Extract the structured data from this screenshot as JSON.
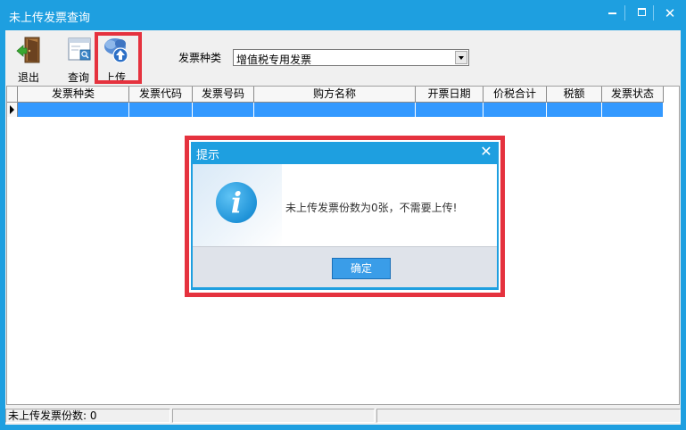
{
  "window": {
    "title": "未上传发票查询",
    "minimize_icon": "minimize-icon",
    "maximize_icon": "maximize-icon",
    "close_glyph": "✕",
    "accent_color": "#1e9fe0"
  },
  "toolbar": {
    "exit_label": "退出",
    "exit_icon": "door-exit-icon",
    "query_label": "查询",
    "query_icon": "search-window-icon",
    "upload_label": "上传",
    "upload_icon": "cloud-upload-icon",
    "invoice_type_label": "发票种类",
    "invoice_type_value": "增值税专用发票"
  },
  "grid": {
    "columns": [
      "发票种类",
      "发票代码",
      "发票号码",
      "购方名称",
      "开票日期",
      "价税合计",
      "税额",
      "发票状态"
    ],
    "selection_color": "#3399ff"
  },
  "status": {
    "count_text": "未上传发票份数: 0"
  },
  "dialog": {
    "title": "提示",
    "close_glyph": "✕",
    "icon": "info-icon",
    "icon_glyph": "i",
    "message": "未上传发票份数为0张，不需要上传!",
    "ok_label": "确定"
  },
  "highlight_color": "#e5323e"
}
